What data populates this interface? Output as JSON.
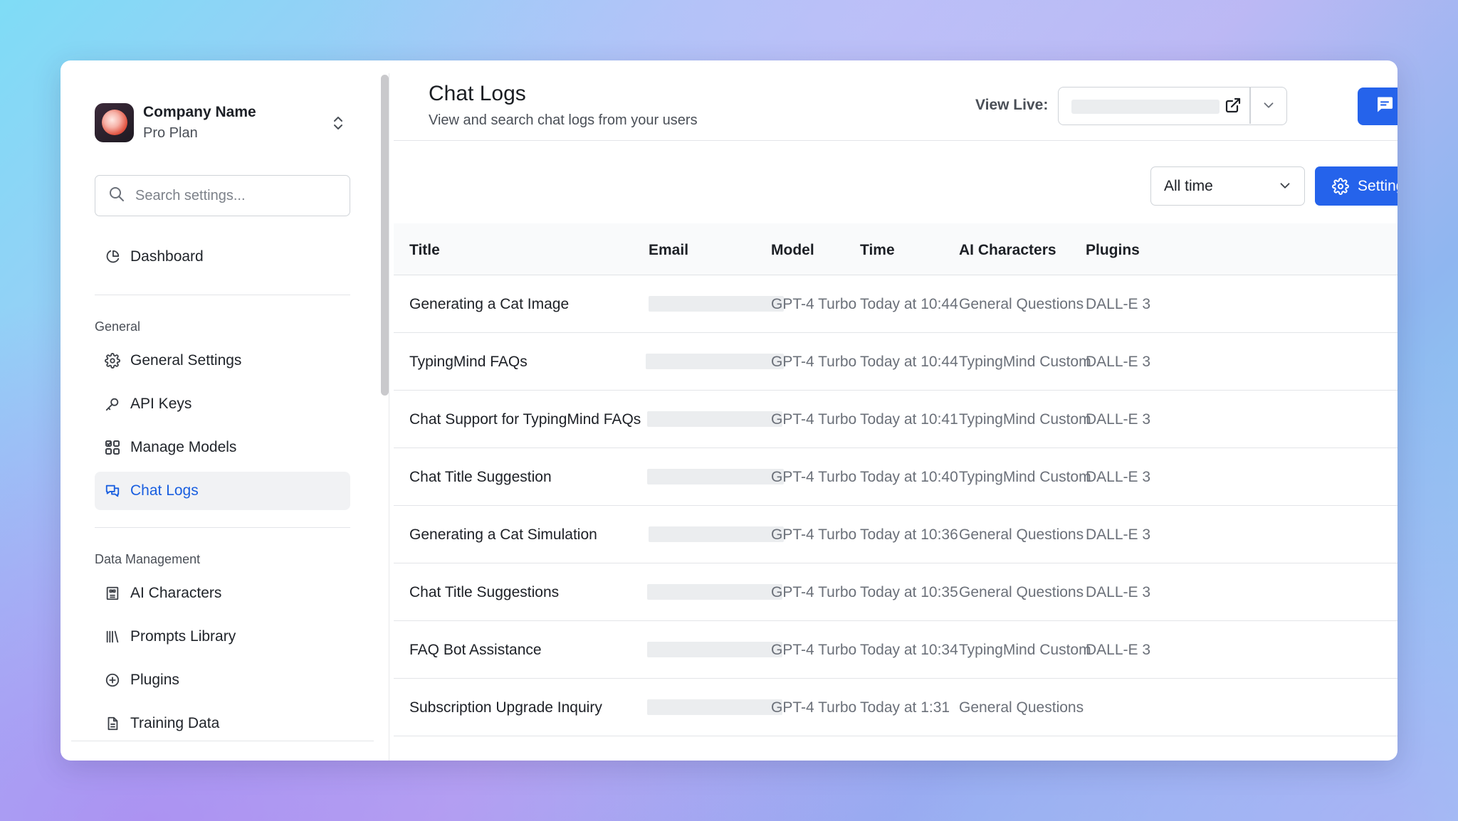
{
  "company": {
    "name": "Company Name",
    "plan": "Pro Plan"
  },
  "search": {
    "placeholder": "Search settings..."
  },
  "nav": {
    "dashboard": "Dashboard",
    "general_label": "General",
    "general_items": [
      "General Settings",
      "API Keys",
      "Manage Models",
      "Chat Logs"
    ],
    "data_label": "Data Management",
    "data_items": [
      "AI Characters",
      "Prompts Library",
      "Plugins",
      "Training Data"
    ],
    "active": "Chat Logs"
  },
  "header": {
    "title": "Chat Logs",
    "subtitle": "View and search chat logs from your users",
    "view_live_label": "View Live:"
  },
  "filters": {
    "time_range": "All time",
    "settings_label": "Settings"
  },
  "table": {
    "columns": [
      "Title",
      "Email",
      "Model",
      "Time",
      "AI Characters",
      "Plugins"
    ],
    "rows": [
      {
        "title": "Generating a Cat Image",
        "model": "GPT-4 Turbo",
        "time": "Today at 10:44",
        "character": "General Questions",
        "plugin": "DALL-E 3"
      },
      {
        "title": "TypingMind FAQs",
        "model": "GPT-4 Turbo",
        "time": "Today at 10:44",
        "character": "TypingMind Custom",
        "plugin": "DALL-E 3"
      },
      {
        "title": "Chat Support for TypingMind FAQs",
        "model": "GPT-4 Turbo",
        "time": "Today at 10:41",
        "character": "TypingMind Custom",
        "plugin": "DALL-E 3"
      },
      {
        "title": "Chat Title Suggestion",
        "model": "GPT-4 Turbo",
        "time": "Today at 10:40",
        "character": "TypingMind Custom",
        "plugin": "DALL-E 3"
      },
      {
        "title": "Generating a Cat Simulation",
        "model": "GPT-4 Turbo",
        "time": "Today at 10:36",
        "character": "General Questions",
        "plugin": "DALL-E 3"
      },
      {
        "title": "Chat Title Suggestions",
        "model": "GPT-4 Turbo",
        "time": "Today at 10:35",
        "character": "General Questions",
        "plugin": "DALL-E 3"
      },
      {
        "title": "FAQ Bot Assistance",
        "model": "GPT-4 Turbo",
        "time": "Today at 10:34",
        "character": "TypingMind Custom",
        "plugin": "DALL-E 3"
      },
      {
        "title": "Subscription Upgrade Inquiry",
        "model": "GPT-4 Turbo",
        "time": "Today at 1:31",
        "character": "General Questions",
        "plugin": ""
      }
    ]
  },
  "colors": {
    "accent": "#2563eb",
    "active_text": "#1a5fe0"
  }
}
